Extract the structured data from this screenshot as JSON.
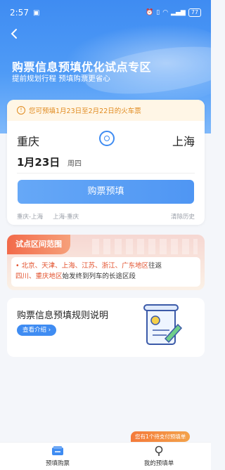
{
  "status": {
    "time": "2:57",
    "battery": "77"
  },
  "header": {
    "title": "购票信息预填优化试点专区",
    "subtitle": "提前规划行程 预填购票更省心"
  },
  "booking": {
    "notice": "您可预填1月23日至2月22日的火车票",
    "from_station": "重庆",
    "to_station": "上海",
    "date": "1月23日",
    "weekday": "周四",
    "submit_label": "购票预填",
    "history": [
      "重庆-上海",
      "上海-重庆"
    ],
    "clear_history": "清除历史"
  },
  "pilot_range": {
    "title": "试点区间范围",
    "line1_cities": "北京、天津、上海、江苏、浙江、广东地区",
    "line1_suffix": "往返",
    "line2_cities": "四川、重庆地区",
    "line2_suffix": "始发终到列车的长途区段"
  },
  "rules": {
    "title": "购票信息预填规则说明",
    "button_label": "查看介绍"
  },
  "pending_badge": "您有1个待支付预填单",
  "tabbar": {
    "left_label": "预填购票",
    "right_label": "我的预填单"
  },
  "colors": {
    "primary": "#3f8cf2",
    "accent_orange": "#e08a1e",
    "highlight_red": "#e2502c"
  }
}
